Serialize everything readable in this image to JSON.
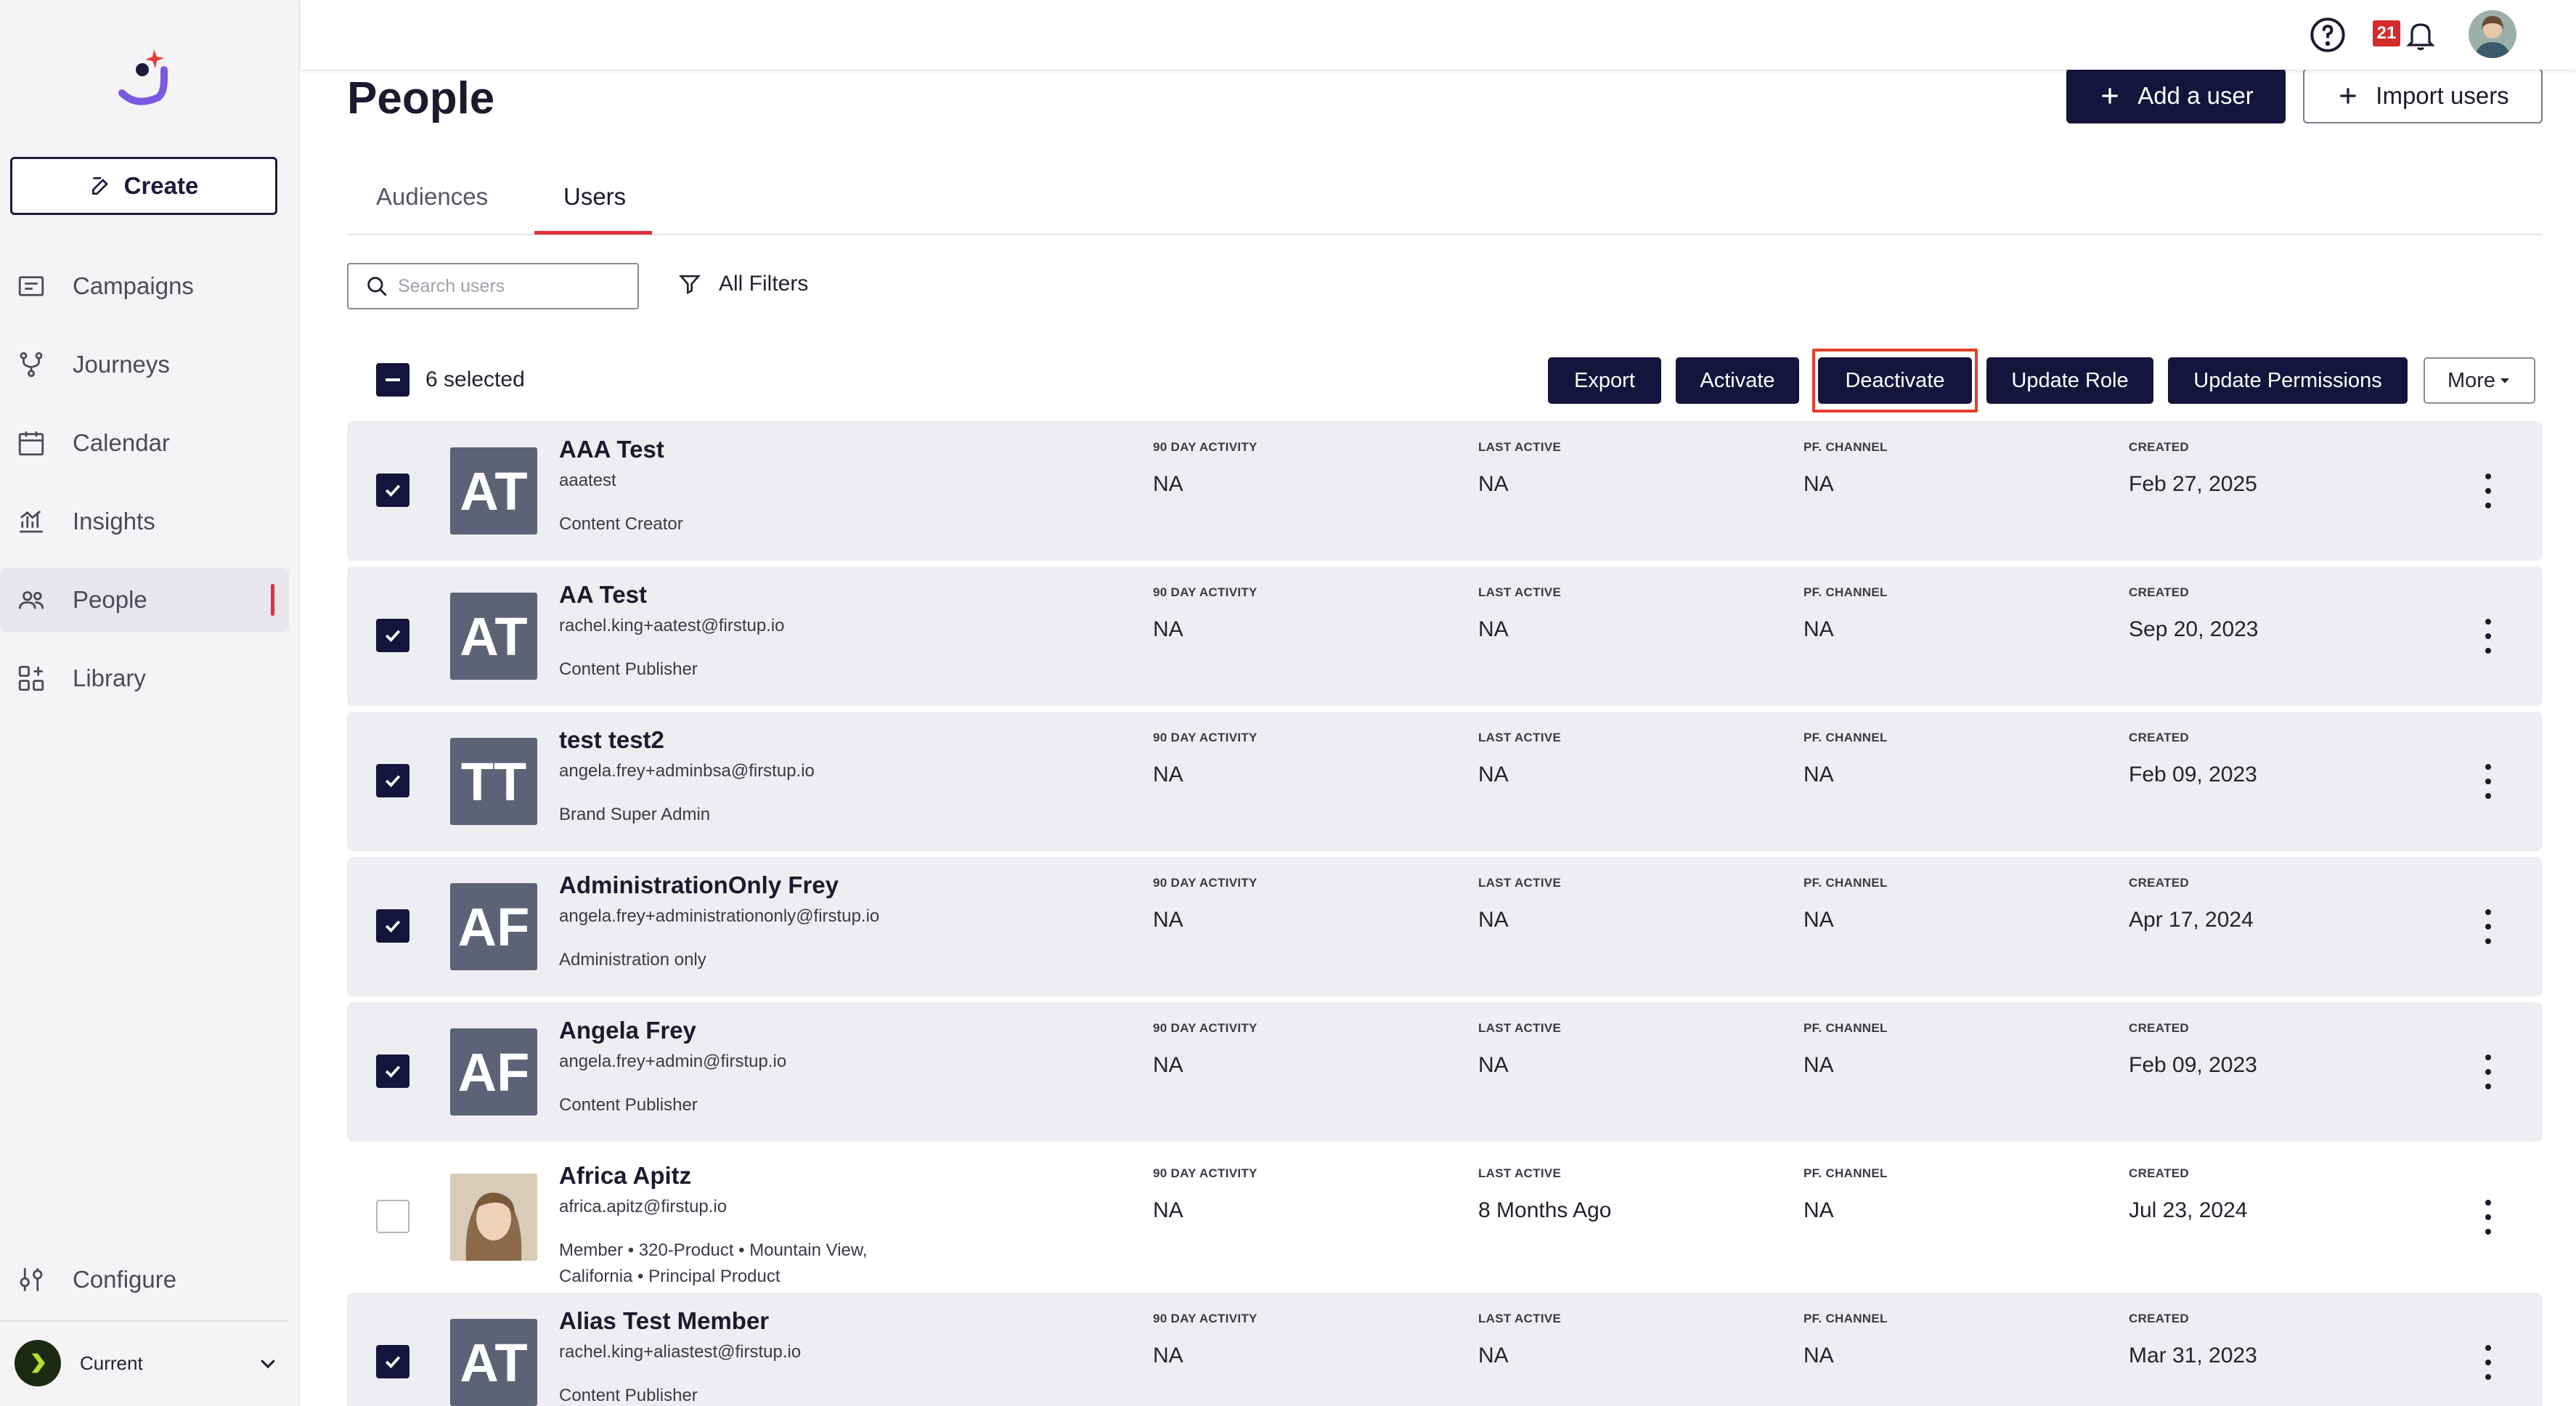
{
  "sidebar": {
    "create_label": "Create",
    "items": [
      {
        "key": "campaigns",
        "label": "Campaigns",
        "icon": "campaigns-icon"
      },
      {
        "key": "journeys",
        "label": "Journeys",
        "icon": "journeys-icon"
      },
      {
        "key": "calendar",
        "label": "Calendar",
        "icon": "calendar-icon"
      },
      {
        "key": "insights",
        "label": "Insights",
        "icon": "insights-icon"
      },
      {
        "key": "people",
        "label": "People",
        "icon": "people-icon",
        "active": true
      },
      {
        "key": "library",
        "label": "Library",
        "icon": "library-icon"
      }
    ],
    "configure_label": "Configure",
    "current_label": "Current"
  },
  "topbar": {
    "notification_count": "21"
  },
  "page": {
    "title": "People",
    "add_user_label": "Add a user",
    "import_users_label": "Import users"
  },
  "tabs": [
    {
      "label": "Audiences",
      "active": false
    },
    {
      "label": "Users",
      "active": true
    }
  ],
  "search": {
    "placeholder": "Search users",
    "value": ""
  },
  "filters_label": "All Filters",
  "selection": {
    "selected_label": "6 selected"
  },
  "actions": {
    "export": "Export",
    "activate": "Activate",
    "deactivate": "Deactivate",
    "update_role": "Update Role",
    "update_permissions": "Update Permissions",
    "more": "More"
  },
  "columns": {
    "activity": "90 DAY ACTIVITY",
    "last_active": "LAST ACTIVE",
    "channel": "PF. CHANNEL",
    "created": "CREATED"
  },
  "users": [
    {
      "initials": "AT",
      "name": "AAA Test",
      "email": "aaatest",
      "role": "Content Creator",
      "activity": "NA",
      "last_active": "NA",
      "channel": "NA",
      "created": "Feb 27, 2025",
      "checked": true
    },
    {
      "initials": "AT",
      "name": "AA Test",
      "email": "rachel.king+aatest@firstup.io",
      "role": "Content Publisher",
      "activity": "NA",
      "last_active": "NA",
      "channel": "NA",
      "created": "Sep 20, 2023",
      "checked": true
    },
    {
      "initials": "TT",
      "name": "test test2",
      "email": "angela.frey+adminbsa@firstup.io",
      "role": "Brand Super Admin",
      "activity": "NA",
      "last_active": "NA",
      "channel": "NA",
      "created": "Feb 09, 2023",
      "checked": true
    },
    {
      "initials": "AF",
      "name": "AdministrationOnly Frey",
      "email": "angela.frey+administrationonly@firstup.io",
      "role": "Administration only",
      "activity": "NA",
      "last_active": "NA",
      "channel": "NA",
      "created": "Apr 17, 2024",
      "checked": true
    },
    {
      "initials": "AF",
      "name": "Angela Frey",
      "email": "angela.frey+admin@firstup.io",
      "role": "Content Publisher",
      "activity": "NA",
      "last_active": "NA",
      "channel": "NA",
      "created": "Feb 09, 2023",
      "checked": true
    },
    {
      "initials": "",
      "photo": true,
      "name": "Africa Apitz",
      "email": "africa.apitz@firstup.io",
      "role": "Member  •   320-Product  •   Mountain View, California  •   Principal Product",
      "activity": "NA",
      "last_active": "8 Months Ago",
      "channel": "NA",
      "created": "Jul 23, 2024",
      "checked": false
    },
    {
      "initials": "AT",
      "name": "Alias Test Member",
      "email": "rachel.king+aliastest@firstup.io",
      "role": "Content Publisher",
      "activity": "NA",
      "last_active": "NA",
      "channel": "NA",
      "created": "Mar 31, 2023",
      "checked": true
    }
  ]
}
